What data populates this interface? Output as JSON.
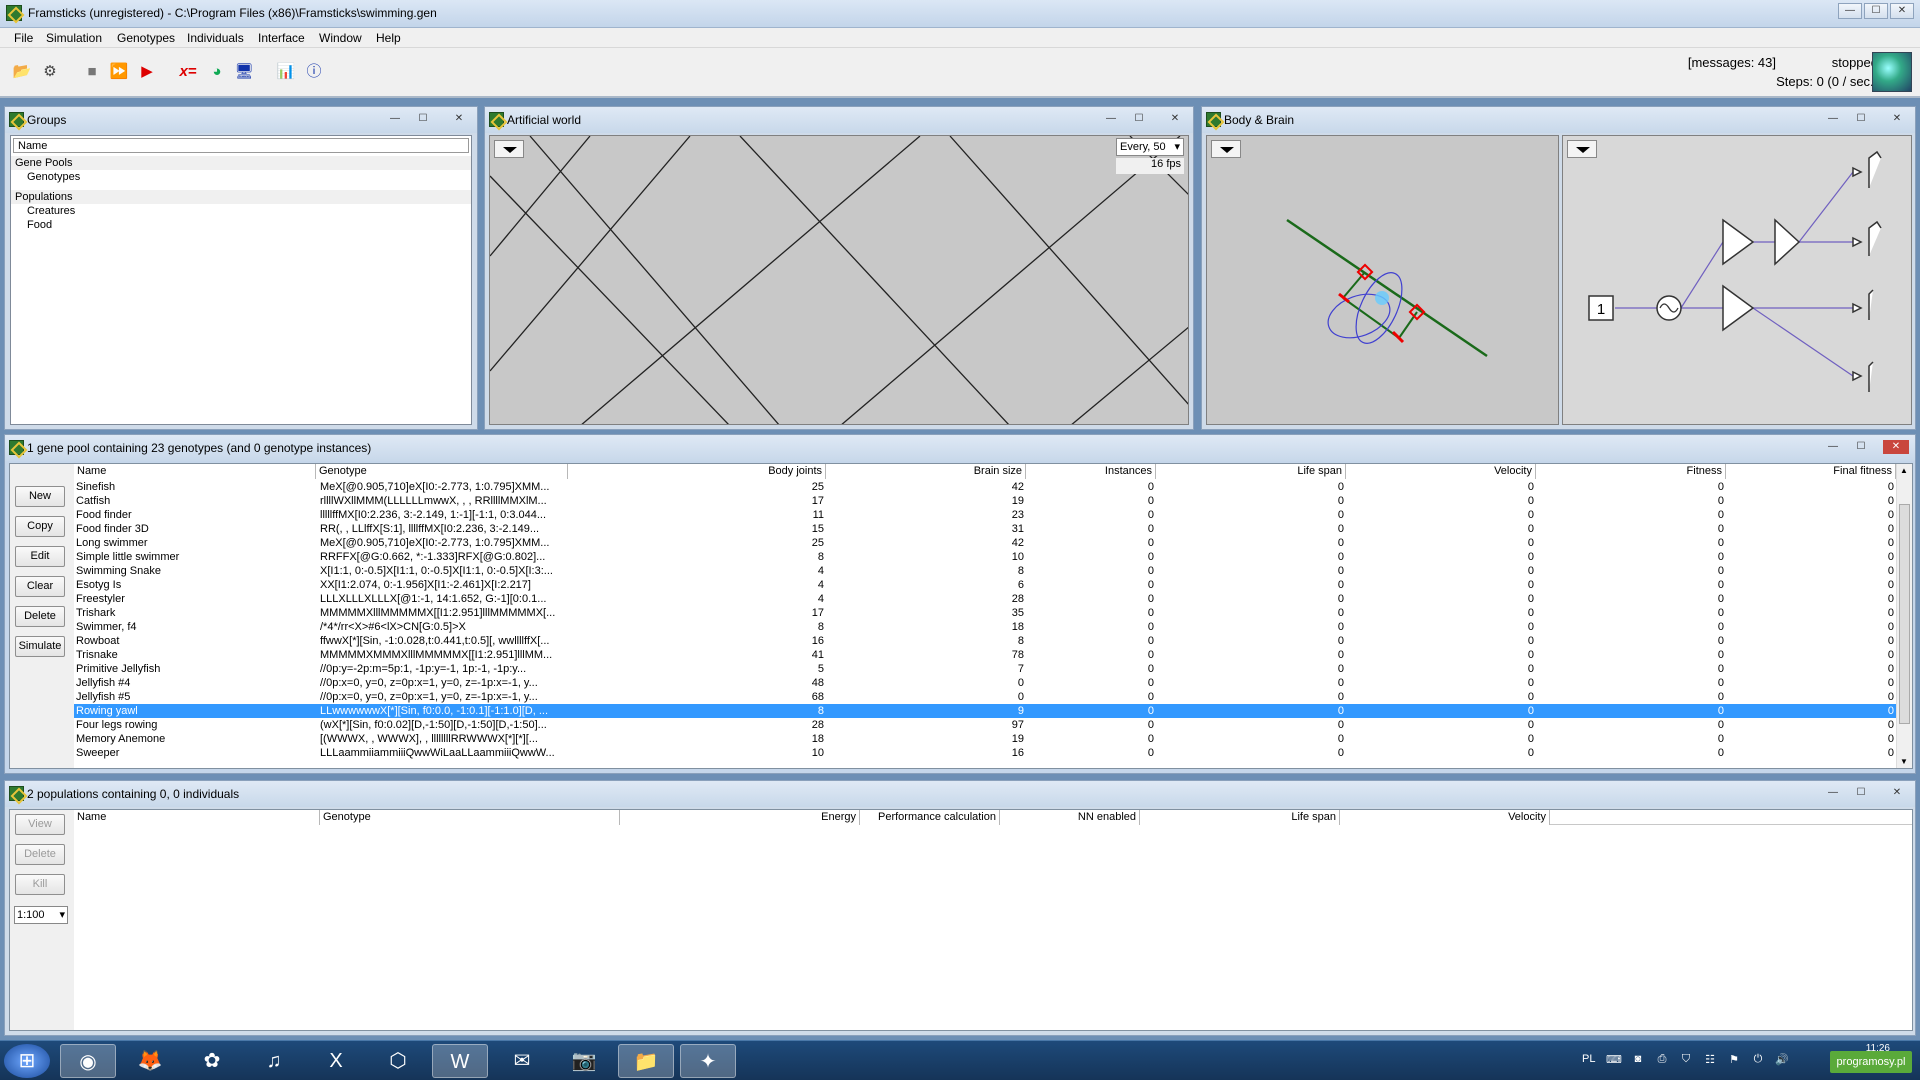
{
  "app": {
    "title": "Framsticks (unregistered) - C:\\Program Files (x86)\\Framsticks\\swimming.gen"
  },
  "menu": [
    "File",
    "Simulation",
    "Genotypes",
    "Individuals",
    "Interface",
    "Window",
    "Help"
  ],
  "toolbar": {
    "tools": [
      "open-icon",
      "settings-icon",
      "stop-icon",
      "step-icon",
      "play-icon",
      "formula-icon",
      "chart-icon",
      "monitor-icon",
      "histogram-icon",
      "info-icon"
    ],
    "formula_label": "x="
  },
  "status": {
    "messages": "[messages: 43]",
    "state": "stopped",
    "steps": "Steps: 0  (0 / sec.)"
  },
  "groups": {
    "title": "Groups",
    "header": "Name",
    "items": [
      {
        "label": "Gene Pools",
        "level": 0
      },
      {
        "label": "Genotypes",
        "level": 1
      },
      {
        "label": "Populations",
        "level": 0
      },
      {
        "label": "Creatures",
        "level": 1
      },
      {
        "label": "Food",
        "level": 1
      }
    ]
  },
  "world": {
    "title": "Artificial world",
    "every": "Every, 50",
    "fps": "16 fps"
  },
  "bodybrain": {
    "title": "Body & Brain",
    "neuron_label": "1"
  },
  "genepool": {
    "title": "1 gene pool containing 23 genotypes (and 0 genotype instances)",
    "buttons": [
      "New",
      "Copy",
      "Edit",
      "Clear",
      "Delete",
      "Simulate"
    ],
    "columns": [
      "Name",
      "Genotype",
      "Body joints",
      "Brain size",
      "Instances",
      "Life span",
      "Velocity",
      "Fitness",
      "Final fitness"
    ],
    "rows": [
      [
        "Sinefish",
        "MeX[@0.905,710]eX[I0:-2.773, 1:0.795]XMM...",
        "25",
        "42",
        "0",
        "0",
        "0",
        "0",
        "0"
      ],
      [
        "Catfish",
        "rllllWXllMMM(LLLLLLmwwX, , , RRllllMMXlM...",
        "17",
        "19",
        "0",
        "0",
        "0",
        "0",
        "0"
      ],
      [
        "Food finder",
        "lllllffMX[I0:2.236, 3:-2.149, 1:-1][-1:1, 0:3.044...",
        "11",
        "23",
        "0",
        "0",
        "0",
        "0",
        "0"
      ],
      [
        "Food finder 3D",
        "RR(, , LLlffX[S:1], llllffMX[I0:2.236, 3:-2.149...",
        "15",
        "31",
        "0",
        "0",
        "0",
        "0",
        "0"
      ],
      [
        "Long swimmer",
        "MeX[@0.905,710]eX[I0:-2.773, 1:0.795]XMM...",
        "25",
        "42",
        "0",
        "0",
        "0",
        "0",
        "0"
      ],
      [
        "Simple little swimmer",
        "RRFFX[@G:0.662, *:-1.333]RFX[@G:0.802]...",
        "8",
        "10",
        "0",
        "0",
        "0",
        "0",
        "0"
      ],
      [
        "Swimming Snake",
        "X[I1:1, 0:-0.5]X[I1:1, 0:-0.5]X[I1:1, 0:-0.5]X[I:3:...",
        "4",
        "8",
        "0",
        "0",
        "0",
        "0",
        "0"
      ],
      [
        "Esotyg Is",
        "XX[I1:2.074, 0:-1.956]X[I1:-2.461]X[I:2.217]",
        "4",
        "6",
        "0",
        "0",
        "0",
        "0",
        "0"
      ],
      [
        "Freestyler",
        "LLLXLLLXLLLX[@1:-1, 14:1.652, G:-1][0:0.1...",
        "4",
        "28",
        "0",
        "0",
        "0",
        "0",
        "0"
      ],
      [
        "Trishark",
        "MMMMMXlllMMMMMX[[I1:2.951]lllMMMMMX[...",
        "17",
        "35",
        "0",
        "0",
        "0",
        "0",
        "0"
      ],
      [
        "Swimmer, f4",
        "/*4*/rr<X>#6<lX>CN[G:0.5]>X",
        "8",
        "18",
        "0",
        "0",
        "0",
        "0",
        "0"
      ],
      [
        "Rowboat",
        "ffwwX[*][Sin, -1:0.028,t:0.441,t:0.5][, wwllllffX[...",
        "16",
        "8",
        "0",
        "0",
        "0",
        "0",
        "0"
      ],
      [
        "Trisnake",
        "MMMMMXMMMXlllMMMMMX[[I1:2.951]lllMM...",
        "41",
        "78",
        "0",
        "0",
        "0",
        "0",
        "0"
      ],
      [
        "Primitive Jellyfish",
        "//0p:y=-2p:m=5p:1, -1p:y=-1, 1p:-1, -1p:y...",
        "5",
        "7",
        "0",
        "0",
        "0",
        "0",
        "0"
      ],
      [
        "Jellyfish #4",
        "//0p:x=0, y=0, z=0p:x=1, y=0, z=-1p:x=-1, y...",
        "48",
        "0",
        "0",
        "0",
        "0",
        "0",
        "0"
      ],
      [
        "Jellyfish #5",
        "//0p:x=0, y=0, z=0p:x=1, y=0, z=-1p:x=-1, y...",
        "68",
        "0",
        "0",
        "0",
        "0",
        "0",
        "0"
      ],
      [
        "Rowing yawl",
        "LLwwwwwwX[*][Sin, f0:0.0, -1:0.1][-1:1.0][D, ...",
        "8",
        "9",
        "0",
        "0",
        "0",
        "0",
        "0"
      ],
      [
        "Four legs rowing",
        "(wX[*][Sin, f0:0.02][D,-1:50][D,-1:50][D,-1:50]...",
        "28",
        "97",
        "0",
        "0",
        "0",
        "0",
        "0"
      ],
      [
        "Memory Anemone",
        "[(WWWX, , WWWX], , llllllllRRWWWX[*][*][...",
        "18",
        "19",
        "0",
        "0",
        "0",
        "0",
        "0"
      ],
      [
        "Sweeper",
        "LLLaammiiammiiiQwwWiLaaLLaammiiiQwwW...",
        "10",
        "16",
        "0",
        "0",
        "0",
        "0",
        "0"
      ]
    ],
    "selected_index": 16
  },
  "populations": {
    "title": "2 populations containing 0, 0 individuals",
    "buttons": [
      "View",
      "Delete",
      "Kill"
    ],
    "zoom": "1:100",
    "columns": [
      "Name",
      "Genotype",
      "Energy",
      "Performance calculation",
      "NN enabled",
      "Life span",
      "Velocity"
    ]
  },
  "taskbar": {
    "apps": [
      "windows-start-icon",
      "chrome-icon",
      "firefox-icon",
      "picasa-icon",
      "itunes-icon",
      "excel-icon",
      "box-icon",
      "word-icon",
      "thunderbird-icon",
      "camera-icon",
      "explorer-icon",
      "framsticks-icon"
    ],
    "language": "PL",
    "watermark": "programosy.pl",
    "time": "11:26"
  }
}
